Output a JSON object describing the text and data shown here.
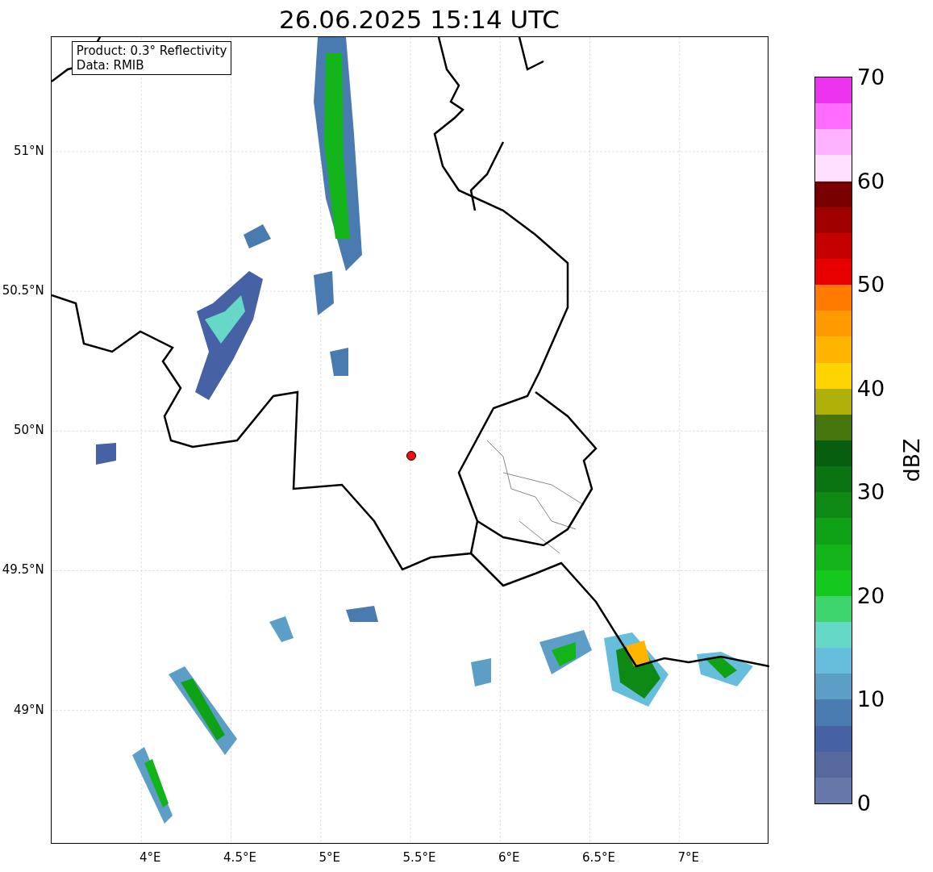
{
  "title": "26.06.2025 15:14 UTC",
  "info_box": {
    "lines": [
      "Product: 0.3° Reflectivity",
      "Data: RMIB"
    ]
  },
  "map": {
    "lat_labels": [
      "51°N",
      "50.5°N",
      "50°N",
      "49.5°N",
      "49°N"
    ],
    "lon_labels": [
      "4°E",
      "4.5°E",
      "5°E",
      "5.5°E",
      "6°E",
      "6.5°E",
      "7°E"
    ]
  },
  "colorbar": {
    "label": "dBZ",
    "ticks": [
      "70",
      "60",
      "50",
      "40",
      "30",
      "20",
      "10",
      "0"
    ],
    "steps": [
      {
        "color": "#ee33ee"
      },
      {
        "color": "#ff6cff"
      },
      {
        "color": "#ffb2ff"
      },
      {
        "color": "#ffe0ff"
      },
      {
        "color": "#780000"
      },
      {
        "color": "#a00000"
      },
      {
        "color": "#c40000"
      },
      {
        "color": "#e80000"
      },
      {
        "color": "#ff7a00"
      },
      {
        "color": "#ff9a00"
      },
      {
        "color": "#ffb400"
      },
      {
        "color": "#ffd400"
      },
      {
        "color": "#b0b00a"
      },
      {
        "color": "#48760e"
      },
      {
        "color": "#075e0e"
      },
      {
        "color": "#0b7412"
      },
      {
        "color": "#0e8a14"
      },
      {
        "color": "#10a216"
      },
      {
        "color": "#12b41a"
      },
      {
        "color": "#14c81e"
      },
      {
        "color": "#3ed46e"
      },
      {
        "color": "#66d8c8"
      },
      {
        "color": "#66bedc"
      },
      {
        "color": "#5c9ec6"
      },
      {
        "color": "#4a7bb0"
      },
      {
        "color": "#4661a4"
      },
      {
        "color": "#55699f"
      },
      {
        "color": "#6677aa"
      }
    ]
  }
}
